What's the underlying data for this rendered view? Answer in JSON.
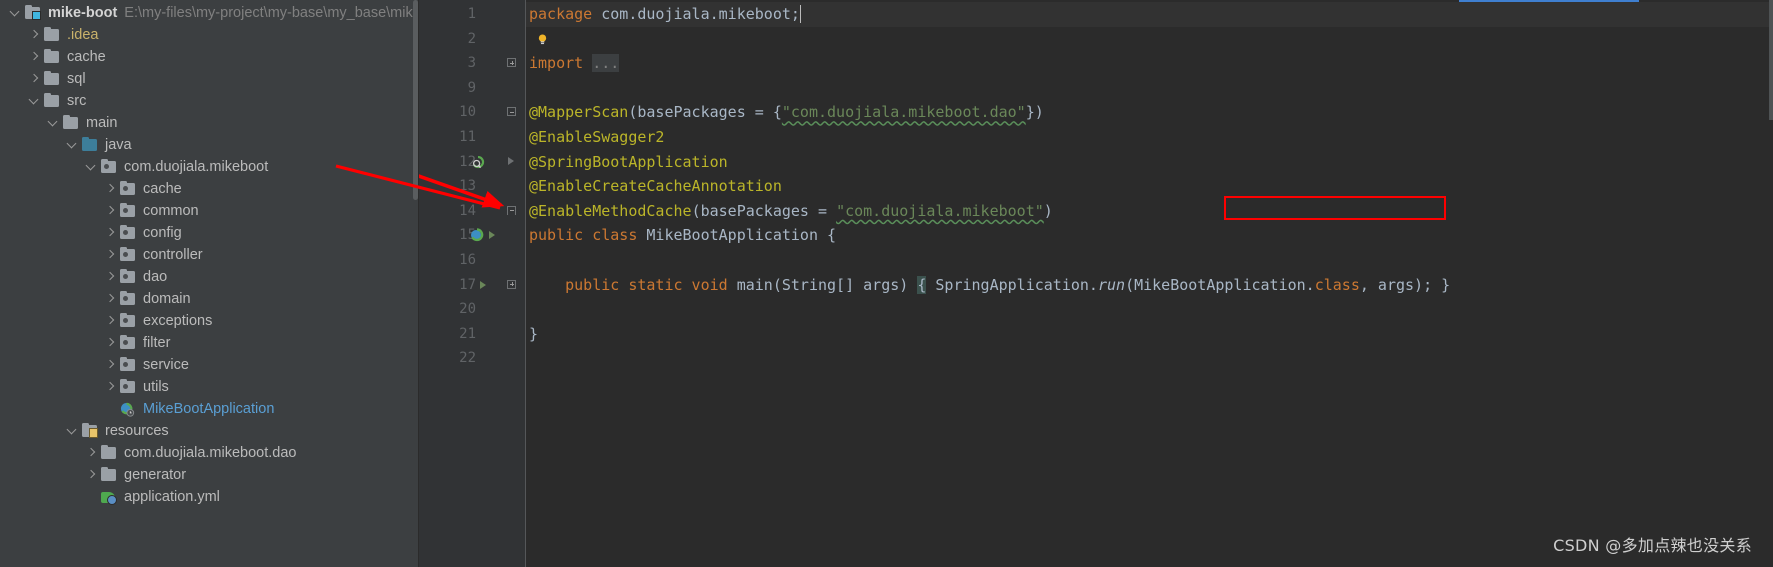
{
  "project_tree": {
    "root": {
      "name": "mike-boot",
      "path": "E:\\my-files\\my-project\\my-base\\my_base\\mik",
      "icon": "module-folder-icon",
      "expanded": true
    },
    "items": [
      {
        "label": ".idea",
        "indent": 1,
        "icon": "folder-icon",
        "arrow": "right",
        "style": "yellow",
        "expanded": false
      },
      {
        "label": "cache",
        "indent": 1,
        "icon": "folder-icon",
        "arrow": "right",
        "style": "plain",
        "expanded": false
      },
      {
        "label": "sql",
        "indent": 1,
        "icon": "folder-icon",
        "arrow": "right",
        "style": "plain",
        "expanded": false
      },
      {
        "label": "src",
        "indent": 1,
        "icon": "folder-icon",
        "arrow": "down",
        "style": "plain",
        "expanded": true
      },
      {
        "label": "main",
        "indent": 2,
        "icon": "folder-icon",
        "arrow": "down",
        "style": "plain",
        "expanded": true
      },
      {
        "label": "java",
        "indent": 3,
        "icon": "source-folder-icon",
        "arrow": "down",
        "style": "plain",
        "expanded": true
      },
      {
        "label": "com.duojiala.mikeboot",
        "indent": 4,
        "icon": "package-icon",
        "arrow": "down",
        "style": "plain",
        "expanded": true
      },
      {
        "label": "cache",
        "indent": 5,
        "icon": "package-icon",
        "arrow": "right",
        "style": "plain",
        "expanded": false
      },
      {
        "label": "common",
        "indent": 5,
        "icon": "package-icon",
        "arrow": "right",
        "style": "plain",
        "expanded": false
      },
      {
        "label": "config",
        "indent": 5,
        "icon": "package-icon",
        "arrow": "right",
        "style": "plain",
        "expanded": false
      },
      {
        "label": "controller",
        "indent": 5,
        "icon": "package-icon",
        "arrow": "right",
        "style": "plain",
        "expanded": false
      },
      {
        "label": "dao",
        "indent": 5,
        "icon": "package-icon",
        "arrow": "right",
        "style": "plain",
        "expanded": false
      },
      {
        "label": "domain",
        "indent": 5,
        "icon": "package-icon",
        "arrow": "right",
        "style": "plain",
        "expanded": false
      },
      {
        "label": "exceptions",
        "indent": 5,
        "icon": "package-icon",
        "arrow": "right",
        "style": "plain",
        "expanded": false
      },
      {
        "label": "filter",
        "indent": 5,
        "icon": "package-icon",
        "arrow": "right",
        "style": "plain",
        "expanded": false
      },
      {
        "label": "service",
        "indent": 5,
        "icon": "package-icon",
        "arrow": "right",
        "style": "plain",
        "expanded": false
      },
      {
        "label": "utils",
        "indent": 5,
        "icon": "package-icon",
        "arrow": "right",
        "style": "plain",
        "expanded": false
      },
      {
        "label": "MikeBootApplication",
        "indent": 5,
        "icon": "spring-class-icon",
        "arrow": "none",
        "style": "blue",
        "expanded": false
      },
      {
        "label": "resources",
        "indent": 3,
        "icon": "resources-folder-icon",
        "arrow": "down",
        "style": "plain",
        "expanded": true
      },
      {
        "label": "com.duojiala.mikeboot.dao",
        "indent": 4,
        "icon": "folder-icon",
        "arrow": "right",
        "style": "plain",
        "expanded": false
      },
      {
        "label": "generator",
        "indent": 4,
        "icon": "folder-icon",
        "arrow": "right",
        "style": "plain",
        "expanded": false
      },
      {
        "label": "application.yml",
        "indent": 4,
        "icon": "yaml-file-icon",
        "arrow": "none",
        "style": "plain",
        "expanded": false
      }
    ]
  },
  "editor": {
    "lines": [
      {
        "num": "1",
        "tokens": [
          {
            "t": "package ",
            "c": "kw"
          },
          {
            "t": "com.duojiala.mikeboot;",
            "c": "plain"
          }
        ],
        "highlight": true,
        "caret": true,
        "fold": "none",
        "gutter_icon": "none"
      },
      {
        "num": "2",
        "tokens": [],
        "highlight": false,
        "fold": "none",
        "gutter_icon": "lightbulb-icon"
      },
      {
        "num": "3",
        "tokens": [
          {
            "t": "import ",
            "c": "kw"
          },
          {
            "t": "...",
            "c": "ellipsis"
          }
        ],
        "highlight": false,
        "fold": "plus",
        "gutter_icon": "none"
      },
      {
        "num": "9",
        "tokens": [],
        "highlight": false,
        "fold": "none",
        "gutter_icon": "none"
      },
      {
        "num": "10",
        "tokens": [
          {
            "t": "@MapperScan",
            "c": "anno"
          },
          {
            "t": "(",
            "c": "plain"
          },
          {
            "t": "basePackages",
            "c": "plain"
          },
          {
            "t": " = {",
            "c": "plain"
          },
          {
            "t": "\"com.duojiala.mikeboot.dao\"",
            "c": "str squiggle"
          },
          {
            "t": "})",
            "c": "plain"
          }
        ],
        "highlight": false,
        "fold": "minus",
        "gutter_icon": "none"
      },
      {
        "num": "11",
        "tokens": [
          {
            "t": "@EnableSwagger2",
            "c": "anno"
          }
        ],
        "highlight": false,
        "fold": "none",
        "gutter_icon": "none"
      },
      {
        "num": "12",
        "tokens": [
          {
            "t": "@SpringBootApplication",
            "c": "anno"
          }
        ],
        "highlight": false,
        "fold": "tri-grey",
        "gutter_icon": "bean-icon"
      },
      {
        "num": "13",
        "tokens": [
          {
            "t": "@EnableCreateCacheAnnotation",
            "c": "anno"
          }
        ],
        "highlight": false,
        "fold": "none",
        "gutter_icon": "none"
      },
      {
        "num": "14",
        "tokens": [
          {
            "t": "@EnableMethodCache",
            "c": "anno"
          },
          {
            "t": "(",
            "c": "plain"
          },
          {
            "t": "basePackages",
            "c": "plain"
          },
          {
            "t": " = ",
            "c": "plain"
          },
          {
            "t": "\"com.duojiala.mikeboot\"",
            "c": "str squiggle"
          },
          {
            "t": ")",
            "c": "plain"
          }
        ],
        "highlight": false,
        "fold": "brace",
        "gutter_icon": "none"
      },
      {
        "num": "15",
        "tokens": [
          {
            "t": "public class ",
            "c": "kw"
          },
          {
            "t": "MikeBootApplication ",
            "c": "cls"
          },
          {
            "t": "{",
            "c": "plain"
          }
        ],
        "highlight": false,
        "fold": "run-tri",
        "gutter_icon": "spring-icon"
      },
      {
        "num": "16",
        "tokens": [],
        "highlight": false,
        "fold": "none",
        "gutter_icon": "none"
      },
      {
        "num": "17",
        "tokens": [
          {
            "t": "    ",
            "c": "plain"
          },
          {
            "t": "public static void ",
            "c": "kw"
          },
          {
            "t": "main",
            "c": "cls"
          },
          {
            "t": "(String[] args) ",
            "c": "plain"
          },
          {
            "t": "{",
            "c": "brace-hl"
          },
          {
            "t": " SpringApplication.",
            "c": "plain"
          },
          {
            "t": "run",
            "c": "ital"
          },
          {
            "t": "(MikeBootApplication.",
            "c": "plain"
          },
          {
            "t": "class",
            "c": "kw"
          },
          {
            "t": ", args);",
            "c": "plain"
          },
          {
            "t": " }",
            "c": "plain"
          }
        ],
        "highlight": false,
        "fold": "plus",
        "gutter_icon": "run-arrow-icon"
      },
      {
        "num": "20",
        "tokens": [],
        "highlight": false,
        "fold": "none",
        "gutter_icon": "none"
      },
      {
        "num": "21",
        "tokens": [
          {
            "t": "}",
            "c": "plain"
          }
        ],
        "highlight": false,
        "fold": "none",
        "gutter_icon": "none"
      },
      {
        "num": "22",
        "tokens": [],
        "highlight": false,
        "fold": "none",
        "gutter_icon": "none"
      }
    ]
  },
  "annotations": {
    "red_arrow": "red-arrow-pointing-at-line-14",
    "red_box_target": "\"com.duojiala.mikeboot\""
  },
  "watermark": {
    "text": "CSDN @多加点辣也没关系"
  },
  "colors": {
    "panel_bg": "#3c3f41",
    "editor_bg": "#2b2b2b",
    "gutter_bg": "#313335",
    "keyword": "#cc7832",
    "annotation": "#bbb529",
    "string": "#6a8759",
    "plain_text": "#a9b7c6",
    "line_number": "#606366",
    "accent_red": "#ff0000",
    "folder_blue": "#3d7e9a"
  }
}
